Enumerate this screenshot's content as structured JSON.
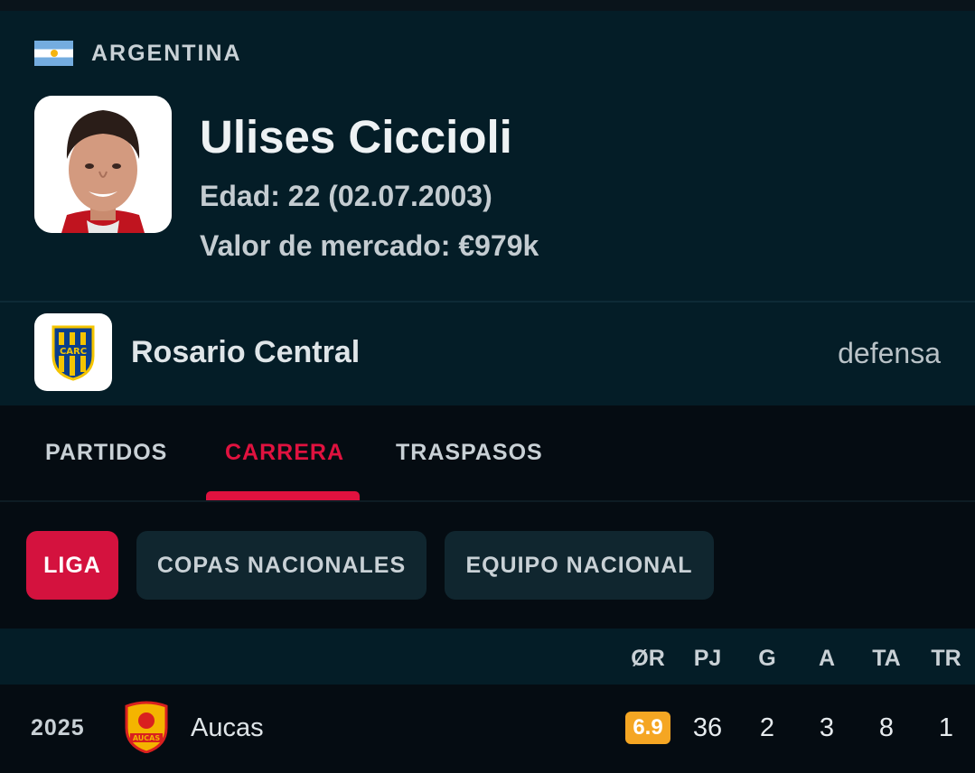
{
  "profile": {
    "country": "ARGENTINA",
    "name": "Ulises Ciccioli",
    "age": "Edad: 22 (02.07.2003)",
    "market_value": "Valor de mercado: €979k"
  },
  "team": {
    "name": "Rosario Central",
    "position": "defensa",
    "logo_text": "CARC"
  },
  "tabs": [
    {
      "label": "PARTIDOS",
      "active": false
    },
    {
      "label": "CARRERA",
      "active": true
    },
    {
      "label": "TRASPASOS",
      "active": false
    }
  ],
  "filters": [
    {
      "label": "LIGA",
      "active": true
    },
    {
      "label": "COPAS NACIONALES",
      "active": false
    },
    {
      "label": "EQUIPO NACIONAL",
      "active": false
    }
  ],
  "table": {
    "headers": [
      "ØR",
      "PJ",
      "G",
      "A",
      "TA",
      "TR"
    ],
    "rows": [
      {
        "year": "2025",
        "team": "Aucas",
        "logo_text": "AUCAS",
        "rating": "6.9",
        "pj": "36",
        "g": "2",
        "a": "3",
        "ta": "8",
        "tr": "1"
      }
    ]
  },
  "colors": {
    "accent": "#e0123f",
    "panel": "#041d27",
    "background": "#050c12",
    "rating": "#f5a623"
  },
  "icons": {
    "flag": "argentina-flag-icon",
    "team": "rosario-central-crest-icon",
    "row_team": "aucas-crest-icon"
  }
}
